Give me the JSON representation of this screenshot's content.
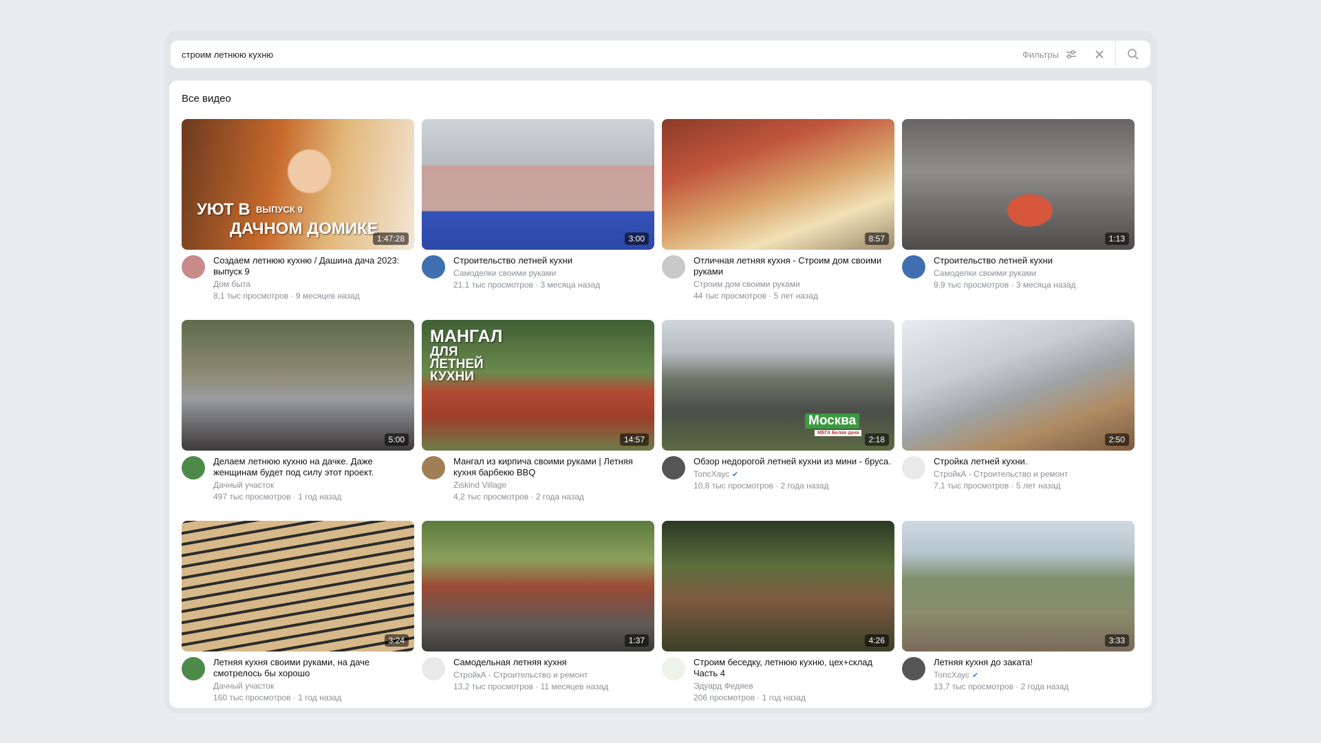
{
  "search": {
    "query": "строим летнюю кухню",
    "filters_label": "Фильтры",
    "filters_icon": "sliders-icon",
    "clear_icon": "close-icon",
    "search_icon": "search-icon"
  },
  "section": {
    "title": "Все видео"
  },
  "videos": [
    {
      "title": "Создаем летнюю кухню / Дашина дача 2023: выпуск 9",
      "channel": "Дом быта",
      "views": "8,1 тыс просмотров",
      "age": "9 месяцев назад",
      "duration": "1:47:28",
      "verified": false,
      "avatar_color": "#c98a8a",
      "thumb_caption_1": "УЮТ В",
      "thumb_caption_2": "ВЫПУСК 9",
      "thumb_caption_3": "ДАЧНОМ ДОМИКЕ"
    },
    {
      "title": "Строительство летней кухни",
      "channel": "Самоделки своими руками",
      "views": "21,1 тыс просмотров",
      "age": "3 месяца назад",
      "duration": "3:00",
      "verified": false,
      "avatar_color": "#3f6fb1"
    },
    {
      "title": "Отличная летняя кухня - Строим дом своими руками",
      "channel": "Строим дом своими руками",
      "views": "44 тыс просмотров",
      "age": "5 лет назад",
      "duration": "8:57",
      "verified": false,
      "avatar_color": "#c9c9c9"
    },
    {
      "title": "Строительство летней кухни",
      "channel": "Самоделки своими руками",
      "views": "9,9 тыс просмотров",
      "age": "3 месяца назад",
      "duration": "1:13",
      "verified": false,
      "avatar_color": "#3f6fb1"
    },
    {
      "title": "Делаем летнюю кухню на дачке. Даже женщинам будет под силу этот проект.",
      "channel": "Дачный участок",
      "views": "497 тыс просмотров",
      "age": "1 год назад",
      "duration": "5:00",
      "verified": false,
      "avatar_color": "#4d8a4a"
    },
    {
      "title": "Мангал из кирпича своими руками | Летняя кухня барбекю BBQ",
      "channel": "Ziskind Village",
      "views": "4,2 тыс просмотров",
      "age": "2 года назад",
      "duration": "14:57",
      "verified": false,
      "avatar_color": "#a07f57",
      "thumb_caption_1": "МАНГАЛ",
      "thumb_caption_2": "ДЛЯ ЛЕТНЕЙ КУХНИ"
    },
    {
      "title": "Обзор недорогой летней кухни из мини - бруса.",
      "channel": "ТопсХаус",
      "views": "10,8 тыс просмотров",
      "age": "2 года назад",
      "duration": "2:18",
      "verified": true,
      "avatar_color": "#555555",
      "thumb_caption_1": "Москва",
      "thumb_caption_2": "МЕГА Белая дача"
    },
    {
      "title": "Стройка летней кухни.",
      "channel": "СтройкА - Строительство и ремонт",
      "views": "7,1 тыс просмотров",
      "age": "5 лет назад",
      "duration": "2:50",
      "verified": false,
      "avatar_color": "#e9e9e9"
    },
    {
      "title": "Летняя кухня своими руками, на даче смотрелось бы хорошо",
      "channel": "Дачный участок",
      "views": "160 тыс просмотров",
      "age": "1 год назад",
      "duration": "3:24",
      "verified": false,
      "avatar_color": "#4d8a4a"
    },
    {
      "title": "Самодельная летняя кухня",
      "channel": "СтройкА - Строительство и ремонт",
      "views": "13,2 тыс просмотров",
      "age": "11 месяцев назад",
      "duration": "1:37",
      "verified": false,
      "avatar_color": "#e9e9e9"
    },
    {
      "title": "Строим беседку, летнюю кухню, цех+склад Часть 4",
      "channel": "Эдуард Федяев",
      "views": "206 просмотров",
      "age": "1 год назад",
      "duration": "4:26",
      "verified": false,
      "avatar_color": "#eef3ea"
    },
    {
      "title": "Летняя кухня до заката!",
      "channel": "ТопсХаус",
      "views": "13,7 тыс просмотров",
      "age": "2 года назад",
      "duration": "3:33",
      "verified": true,
      "avatar_color": "#555555"
    }
  ]
}
